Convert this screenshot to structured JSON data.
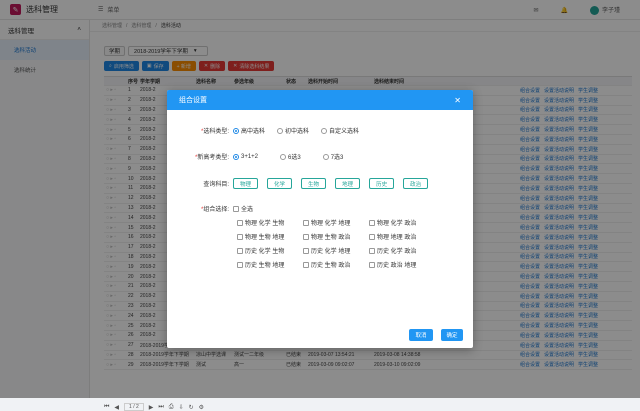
{
  "app": {
    "title": "选科管理",
    "menu_label": "菜单",
    "user": "李子瑾",
    "logo_glyph": "✉"
  },
  "sidebar": {
    "group": "选科管理",
    "items": [
      "选科活动",
      "选科统计"
    ]
  },
  "breadcrumb": [
    "选科管理",
    "选科管理",
    "选科活动"
  ],
  "filter": {
    "label": "学期",
    "value": "2018-2019学年下学期"
  },
  "toolbar": [
    "启用筛选",
    "保存",
    "+ 新增",
    "删除",
    "清除选科结果"
  ],
  "table": {
    "headers": [
      "",
      "序号",
      "学年学期",
      "选科名称",
      "参选年级",
      "状态",
      "选科开始时间",
      "选科结束时间",
      "",
      ""
    ],
    "rows": [
      {
        "n": "1",
        "term": "2018-2",
        "name": "",
        "grade": "",
        "status": "",
        "start": "",
        "end": ""
      },
      {
        "n": "2",
        "term": "2018-2",
        "name": "",
        "grade": "",
        "status": "",
        "start": "",
        "end": ""
      },
      {
        "n": "3",
        "term": "2018-2",
        "name": "",
        "grade": "",
        "status": "",
        "start": "",
        "end": ""
      },
      {
        "n": "4",
        "term": "2018-2",
        "name": "",
        "grade": "",
        "status": "",
        "start": "",
        "end": ""
      },
      {
        "n": "5",
        "term": "2018-2",
        "name": "",
        "grade": "",
        "status": "",
        "start": "",
        "end": ""
      },
      {
        "n": "6",
        "term": "2018-2",
        "name": "",
        "grade": "",
        "status": "",
        "start": "",
        "end": ""
      },
      {
        "n": "7",
        "term": "2018-2",
        "name": "",
        "grade": "",
        "status": "",
        "start": "",
        "end": ""
      },
      {
        "n": "8",
        "term": "2018-2",
        "name": "",
        "grade": "",
        "status": "",
        "start": "",
        "end": ""
      },
      {
        "n": "9",
        "term": "2018-2",
        "name": "",
        "grade": "",
        "status": "",
        "start": "",
        "end": ""
      },
      {
        "n": "10",
        "term": "2018-2",
        "name": "",
        "grade": "",
        "status": "",
        "start": "",
        "end": ""
      },
      {
        "n": "11",
        "term": "2018-2",
        "name": "",
        "grade": "",
        "status": "",
        "start": "",
        "end": ""
      },
      {
        "n": "12",
        "term": "2018-2",
        "name": "",
        "grade": "",
        "status": "",
        "start": "",
        "end": ""
      },
      {
        "n": "13",
        "term": "2018-2",
        "name": "",
        "grade": "",
        "status": "",
        "start": "",
        "end": ""
      },
      {
        "n": "14",
        "term": "2018-2",
        "name": "",
        "grade": "",
        "status": "",
        "start": "",
        "end": ""
      },
      {
        "n": "15",
        "term": "2018-2",
        "name": "",
        "grade": "",
        "status": "",
        "start": "",
        "end": ""
      },
      {
        "n": "16",
        "term": "2018-2",
        "name": "",
        "grade": "",
        "status": "",
        "start": "",
        "end": ""
      },
      {
        "n": "17",
        "term": "2018-2",
        "name": "",
        "grade": "",
        "status": "",
        "start": "",
        "end": ""
      },
      {
        "n": "18",
        "term": "2018-2",
        "name": "",
        "grade": "",
        "status": "",
        "start": "",
        "end": ""
      },
      {
        "n": "19",
        "term": "2018-2",
        "name": "",
        "grade": "",
        "status": "",
        "start": "",
        "end": ""
      },
      {
        "n": "20",
        "term": "2018-2",
        "name": "",
        "grade": "",
        "status": "",
        "start": "",
        "end": ""
      },
      {
        "n": "21",
        "term": "2018-2",
        "name": "",
        "grade": "",
        "status": "",
        "start": "",
        "end": ""
      },
      {
        "n": "22",
        "term": "2018-2",
        "name": "",
        "grade": "",
        "status": "",
        "start": "",
        "end": ""
      },
      {
        "n": "23",
        "term": "2018-2",
        "name": "",
        "grade": "",
        "status": "",
        "start": "",
        "end": ""
      },
      {
        "n": "24",
        "term": "2018-2",
        "name": "",
        "grade": "",
        "status": "",
        "start": "",
        "end": ""
      },
      {
        "n": "25",
        "term": "2018-2",
        "name": "",
        "grade": "",
        "status": "",
        "start": "",
        "end": ""
      },
      {
        "n": "26",
        "term": "2018-2",
        "name": "",
        "grade": "",
        "status": "",
        "start": "",
        "end": ""
      },
      {
        "n": "27",
        "term": "2018-2019学年下学期",
        "name": "七选三",
        "grade": "高一",
        "status": "已结束",
        "start": "2019-03-09 09:02:07",
        "end": "2019-03-10 09:02:09"
      },
      {
        "n": "28",
        "term": "2018-2019学年下学期",
        "name": "凉山中学选课",
        "grade": "测试一二年级",
        "status": "已结束",
        "start": "2019-03-07 13:54:21",
        "end": "2019-03-08 14:38:58"
      },
      {
        "n": "29",
        "term": "2018-2019学年下学期",
        "name": "测试",
        "grade": "高一",
        "status": "已结束",
        "start": "2019-03-09 09:02:07",
        "end": "2019-03-10 09:02:09"
      }
    ],
    "actions": [
      "组合设置",
      "设置活动说明",
      "学生调整"
    ]
  },
  "pager": {
    "page": "1",
    "total": "2"
  },
  "modal": {
    "title": "组合设置",
    "type_label": "选科类型:",
    "types": [
      "高中选科",
      "初中选科",
      "自定义选科"
    ],
    "exam_label": "新高考类型:",
    "exams": [
      "3+1+2",
      "6选3",
      "7选3"
    ],
    "subject_label": "查询科目:",
    "subjects": [
      "物理",
      "化学",
      "生物",
      "地理",
      "历史",
      "政治"
    ],
    "combo_label": "组合选择:",
    "select_all": "全选",
    "combos": [
      "物理 化学 生物",
      "物理 化学 地理",
      "物理 化学 政治",
      "物理 生物 地理",
      "物理 生物 政治",
      "物理 地理 政治",
      "历史 化学 生物",
      "历史 化学 地理",
      "历史 化学 政治",
      "历史 生物 地理",
      "历史 生物 政治",
      "历史 政治 地理"
    ],
    "cancel": "取消",
    "confirm": "确定"
  }
}
